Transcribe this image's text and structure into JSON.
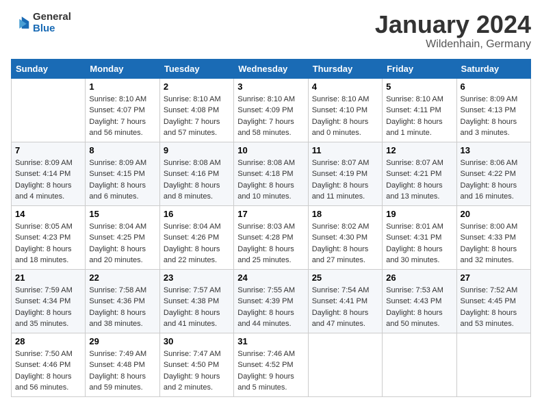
{
  "logo": {
    "part1": "General",
    "part2": "Blue"
  },
  "title": "January 2024",
  "location": "Wildenhain, Germany",
  "days_of_week": [
    "Sunday",
    "Monday",
    "Tuesday",
    "Wednesday",
    "Thursday",
    "Friday",
    "Saturday"
  ],
  "weeks": [
    [
      {
        "num": "",
        "sunrise": "",
        "sunset": "",
        "daylight": ""
      },
      {
        "num": "1",
        "sunrise": "Sunrise: 8:10 AM",
        "sunset": "Sunset: 4:07 PM",
        "daylight": "Daylight: 7 hours and 56 minutes."
      },
      {
        "num": "2",
        "sunrise": "Sunrise: 8:10 AM",
        "sunset": "Sunset: 4:08 PM",
        "daylight": "Daylight: 7 hours and 57 minutes."
      },
      {
        "num": "3",
        "sunrise": "Sunrise: 8:10 AM",
        "sunset": "Sunset: 4:09 PM",
        "daylight": "Daylight: 7 hours and 58 minutes."
      },
      {
        "num": "4",
        "sunrise": "Sunrise: 8:10 AM",
        "sunset": "Sunset: 4:10 PM",
        "daylight": "Daylight: 8 hours and 0 minutes."
      },
      {
        "num": "5",
        "sunrise": "Sunrise: 8:10 AM",
        "sunset": "Sunset: 4:11 PM",
        "daylight": "Daylight: 8 hours and 1 minute."
      },
      {
        "num": "6",
        "sunrise": "Sunrise: 8:09 AM",
        "sunset": "Sunset: 4:13 PM",
        "daylight": "Daylight: 8 hours and 3 minutes."
      }
    ],
    [
      {
        "num": "7",
        "sunrise": "Sunrise: 8:09 AM",
        "sunset": "Sunset: 4:14 PM",
        "daylight": "Daylight: 8 hours and 4 minutes."
      },
      {
        "num": "8",
        "sunrise": "Sunrise: 8:09 AM",
        "sunset": "Sunset: 4:15 PM",
        "daylight": "Daylight: 8 hours and 6 minutes."
      },
      {
        "num": "9",
        "sunrise": "Sunrise: 8:08 AM",
        "sunset": "Sunset: 4:16 PM",
        "daylight": "Daylight: 8 hours and 8 minutes."
      },
      {
        "num": "10",
        "sunrise": "Sunrise: 8:08 AM",
        "sunset": "Sunset: 4:18 PM",
        "daylight": "Daylight: 8 hours and 10 minutes."
      },
      {
        "num": "11",
        "sunrise": "Sunrise: 8:07 AM",
        "sunset": "Sunset: 4:19 PM",
        "daylight": "Daylight: 8 hours and 11 minutes."
      },
      {
        "num": "12",
        "sunrise": "Sunrise: 8:07 AM",
        "sunset": "Sunset: 4:21 PM",
        "daylight": "Daylight: 8 hours and 13 minutes."
      },
      {
        "num": "13",
        "sunrise": "Sunrise: 8:06 AM",
        "sunset": "Sunset: 4:22 PM",
        "daylight": "Daylight: 8 hours and 16 minutes."
      }
    ],
    [
      {
        "num": "14",
        "sunrise": "Sunrise: 8:05 AM",
        "sunset": "Sunset: 4:23 PM",
        "daylight": "Daylight: 8 hours and 18 minutes."
      },
      {
        "num": "15",
        "sunrise": "Sunrise: 8:04 AM",
        "sunset": "Sunset: 4:25 PM",
        "daylight": "Daylight: 8 hours and 20 minutes."
      },
      {
        "num": "16",
        "sunrise": "Sunrise: 8:04 AM",
        "sunset": "Sunset: 4:26 PM",
        "daylight": "Daylight: 8 hours and 22 minutes."
      },
      {
        "num": "17",
        "sunrise": "Sunrise: 8:03 AM",
        "sunset": "Sunset: 4:28 PM",
        "daylight": "Daylight: 8 hours and 25 minutes."
      },
      {
        "num": "18",
        "sunrise": "Sunrise: 8:02 AM",
        "sunset": "Sunset: 4:30 PM",
        "daylight": "Daylight: 8 hours and 27 minutes."
      },
      {
        "num": "19",
        "sunrise": "Sunrise: 8:01 AM",
        "sunset": "Sunset: 4:31 PM",
        "daylight": "Daylight: 8 hours and 30 minutes."
      },
      {
        "num": "20",
        "sunrise": "Sunrise: 8:00 AM",
        "sunset": "Sunset: 4:33 PM",
        "daylight": "Daylight: 8 hours and 32 minutes."
      }
    ],
    [
      {
        "num": "21",
        "sunrise": "Sunrise: 7:59 AM",
        "sunset": "Sunset: 4:34 PM",
        "daylight": "Daylight: 8 hours and 35 minutes."
      },
      {
        "num": "22",
        "sunrise": "Sunrise: 7:58 AM",
        "sunset": "Sunset: 4:36 PM",
        "daylight": "Daylight: 8 hours and 38 minutes."
      },
      {
        "num": "23",
        "sunrise": "Sunrise: 7:57 AM",
        "sunset": "Sunset: 4:38 PM",
        "daylight": "Daylight: 8 hours and 41 minutes."
      },
      {
        "num": "24",
        "sunrise": "Sunrise: 7:55 AM",
        "sunset": "Sunset: 4:39 PM",
        "daylight": "Daylight: 8 hours and 44 minutes."
      },
      {
        "num": "25",
        "sunrise": "Sunrise: 7:54 AM",
        "sunset": "Sunset: 4:41 PM",
        "daylight": "Daylight: 8 hours and 47 minutes."
      },
      {
        "num": "26",
        "sunrise": "Sunrise: 7:53 AM",
        "sunset": "Sunset: 4:43 PM",
        "daylight": "Daylight: 8 hours and 50 minutes."
      },
      {
        "num": "27",
        "sunrise": "Sunrise: 7:52 AM",
        "sunset": "Sunset: 4:45 PM",
        "daylight": "Daylight: 8 hours and 53 minutes."
      }
    ],
    [
      {
        "num": "28",
        "sunrise": "Sunrise: 7:50 AM",
        "sunset": "Sunset: 4:46 PM",
        "daylight": "Daylight: 8 hours and 56 minutes."
      },
      {
        "num": "29",
        "sunrise": "Sunrise: 7:49 AM",
        "sunset": "Sunset: 4:48 PM",
        "daylight": "Daylight: 8 hours and 59 minutes."
      },
      {
        "num": "30",
        "sunrise": "Sunrise: 7:47 AM",
        "sunset": "Sunset: 4:50 PM",
        "daylight": "Daylight: 9 hours and 2 minutes."
      },
      {
        "num": "31",
        "sunrise": "Sunrise: 7:46 AM",
        "sunset": "Sunset: 4:52 PM",
        "daylight": "Daylight: 9 hours and 5 minutes."
      },
      {
        "num": "",
        "sunrise": "",
        "sunset": "",
        "daylight": ""
      },
      {
        "num": "",
        "sunrise": "",
        "sunset": "",
        "daylight": ""
      },
      {
        "num": "",
        "sunrise": "",
        "sunset": "",
        "daylight": ""
      }
    ]
  ]
}
